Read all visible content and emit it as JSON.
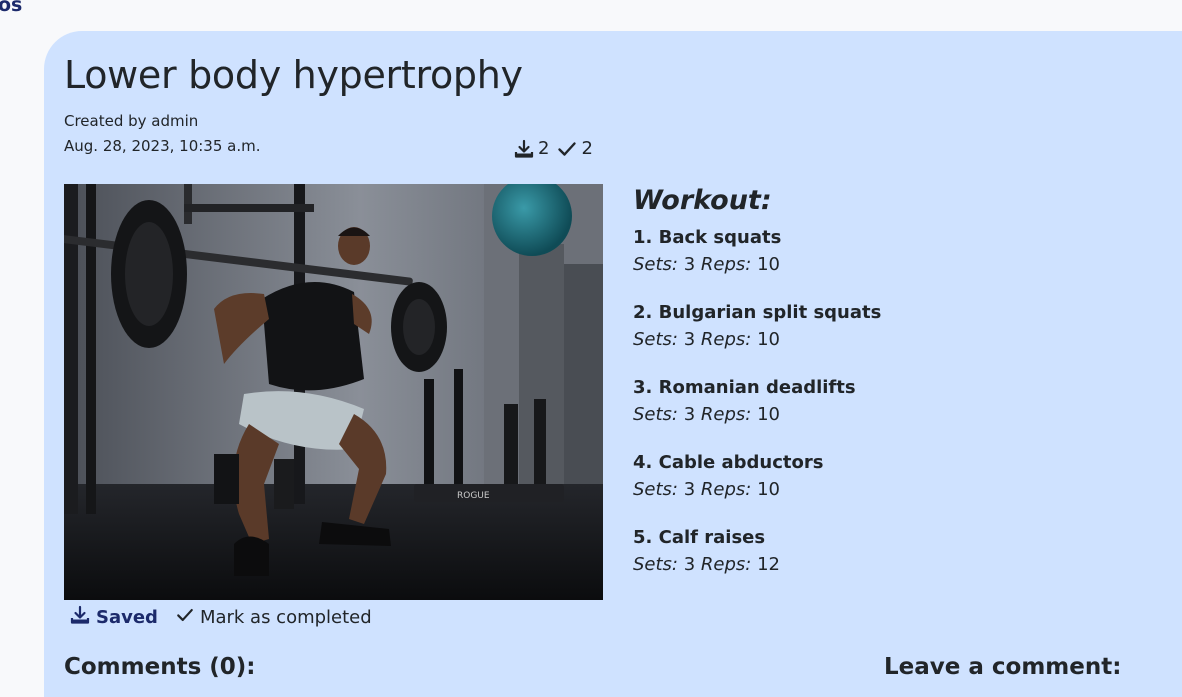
{
  "nav": {
    "fragment": "os"
  },
  "workout": {
    "title": "Lower body hypertrophy",
    "author_line": "Created by admin",
    "date": "Aug. 28, 2023, 10:35 a.m.",
    "saves_count": "2",
    "completions_count": "2",
    "image_alt": "Man performing a barbell squat in a gym",
    "heading": "Workout:",
    "sets_label": "Sets:",
    "reps_label": "Reps:",
    "exercises": [
      {
        "name": "1. Back squats",
        "sets": "3",
        "reps": "10"
      },
      {
        "name": "2. Bulgarian split squats",
        "sets": "3",
        "reps": "10"
      },
      {
        "name": "3. Romanian deadlifts",
        "sets": "3",
        "reps": "10"
      },
      {
        "name": "4. Cable abductors",
        "sets": "3",
        "reps": "10"
      },
      {
        "name": "5. Calf raises",
        "sets": "3",
        "reps": "12"
      }
    ]
  },
  "actions": {
    "saved_label": "Saved",
    "complete_label": "Mark as completed"
  },
  "comments": {
    "title": "Comments (0):",
    "leave_title": "Leave a comment:"
  },
  "colors": {
    "card_bg": "#cfe2ff",
    "page_bg": "#f8f9fb",
    "accent": "#1c2a6b"
  },
  "icons": [
    "download-icon",
    "check-icon"
  ],
  "photo_logo": "ROGUE"
}
